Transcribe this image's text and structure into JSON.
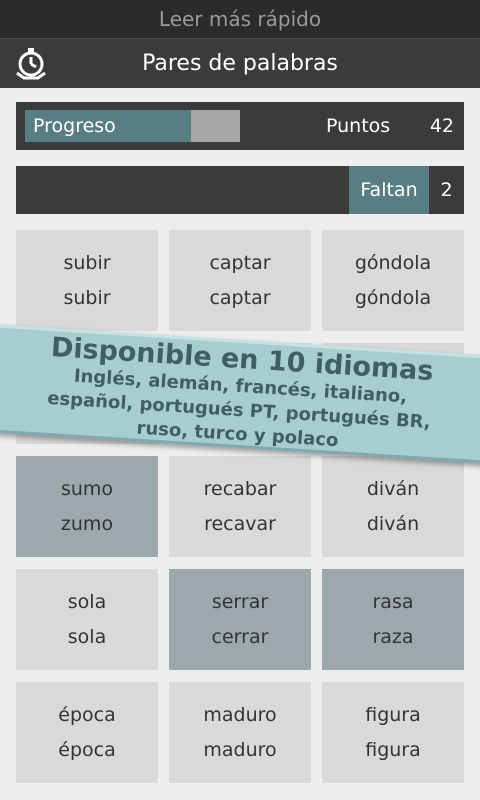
{
  "app": {
    "window_title": "Leer más rápido"
  },
  "header": {
    "title": "Pares de palabras",
    "icon": "stopwatch-icon"
  },
  "stats": {
    "progress_label": "Progreso",
    "progress_fraction": 0.77,
    "points_label": "Puntos",
    "points_value": "42",
    "remaining_label": "Faltan",
    "remaining_value": "2"
  },
  "colors": {
    "accent": "#587d83",
    "card_same": "#d9d9d9",
    "card_different": "#9da8ad",
    "banner": "#a8cdd0"
  },
  "cards": [
    {
      "word1": "subir",
      "word2": "subir",
      "different": false
    },
    {
      "word1": "captar",
      "word2": "captar",
      "different": false
    },
    {
      "word1": "góndola",
      "word2": "góndola",
      "different": false
    },
    {
      "word1": "",
      "word2": "",
      "different": false
    },
    {
      "word1": "",
      "word2": "",
      "different": false
    },
    {
      "word1": "",
      "word2": "",
      "different": false
    },
    {
      "word1": "sumo",
      "word2": "zumo",
      "different": true
    },
    {
      "word1": "recabar",
      "word2": "recavar",
      "different": false
    },
    {
      "word1": "diván",
      "word2": "diván",
      "different": false
    },
    {
      "word1": "sola",
      "word2": "sola",
      "different": false
    },
    {
      "word1": "serrar",
      "word2": "cerrar",
      "different": true
    },
    {
      "word1": "rasa",
      "word2": "raza",
      "different": true
    },
    {
      "word1": "época",
      "word2": "época",
      "different": false
    },
    {
      "word1": "maduro",
      "word2": "maduro",
      "different": false
    },
    {
      "word1": "figura",
      "word2": "figura",
      "different": false
    }
  ],
  "promo": {
    "title": "Disponible en 10 idiomas",
    "languages": "Inglés, alemán, francés, italiano, español, portugués PT, portugués BR, ruso, turco y polaco"
  }
}
